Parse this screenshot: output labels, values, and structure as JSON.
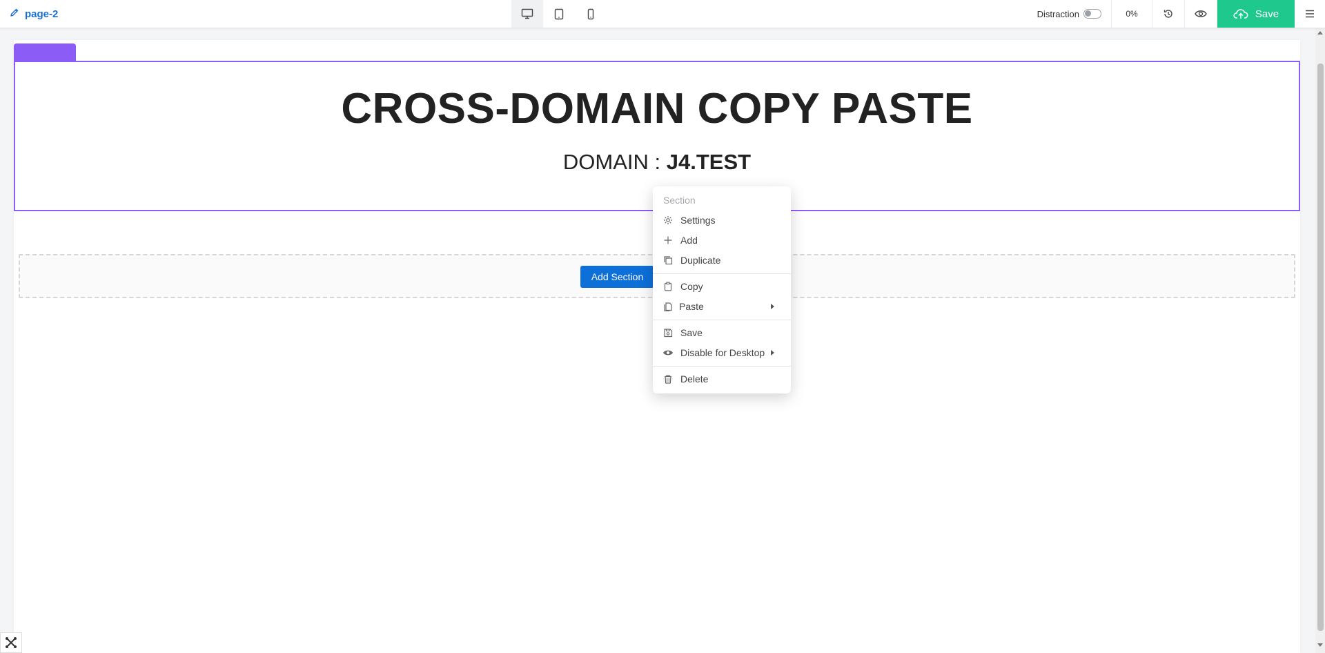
{
  "topbar": {
    "page_name": "page-2",
    "distraction_label": "Distraction",
    "zoom": "0%",
    "save_label": "Save"
  },
  "section": {
    "headline": "CROSS-DOMAIN COPY PASTE",
    "domain_prefix": "DOMAIN : ",
    "domain_value": "J4.TEST"
  },
  "add_section_label": "Add Section",
  "context_menu": {
    "title": "Section",
    "settings": "Settings",
    "add": "Add",
    "duplicate": "Duplicate",
    "copy": "Copy",
    "paste": "Paste",
    "save": "Save",
    "disable": "Disable for Desktop",
    "delete": "Delete"
  },
  "colors": {
    "accent": "#8b5cf6",
    "save": "#1fc98d",
    "primary": "#0d6fd8",
    "link": "#1a6fd1"
  }
}
